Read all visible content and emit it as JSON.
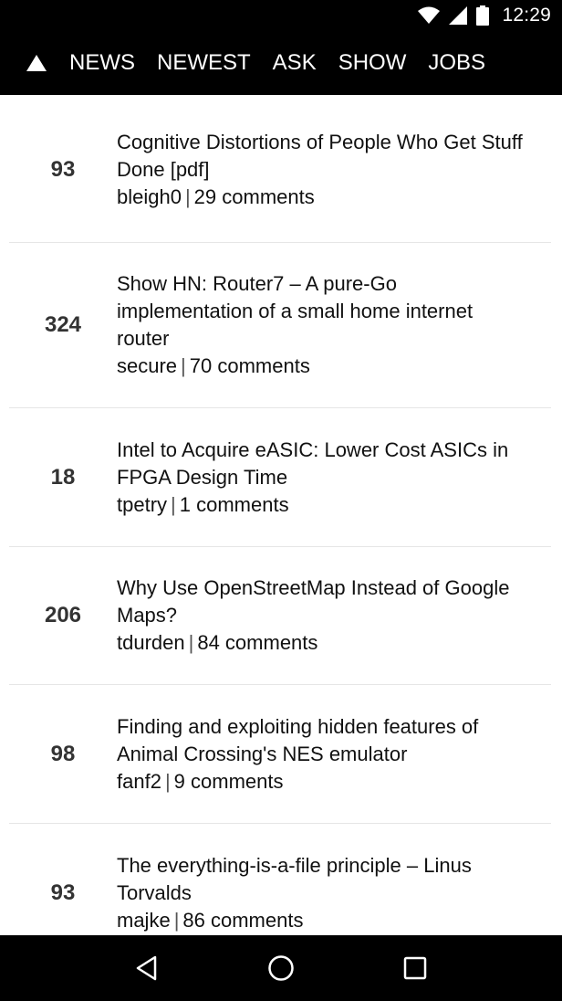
{
  "status_bar": {
    "time": "12:29",
    "icons": [
      "wifi-icon",
      "cell-signal-icon",
      "battery-icon"
    ]
  },
  "header": {
    "logo_icon": "triangle-up-icon",
    "tabs": [
      {
        "label": "NEWS"
      },
      {
        "label": "NEWEST"
      },
      {
        "label": "ASK"
      },
      {
        "label": "SHOW"
      },
      {
        "label": "JOBS"
      }
    ]
  },
  "stories": [
    {
      "score": "93",
      "title": "Cognitive Distortions of People Who Get Stuff Done [pdf]",
      "author": "bleigh0",
      "comments": "29 comments"
    },
    {
      "score": "324",
      "title": "Show HN: Router7 – A pure-Go implementation of a small home internet router",
      "author": "secure",
      "comments": "70 comments"
    },
    {
      "score": "18",
      "title": "Intel to Acquire eASIC: Lower Cost ASICs in FPGA Design Time",
      "author": "tpetry",
      "comments": "1 comments"
    },
    {
      "score": "206",
      "title": "Why Use OpenStreetMap Instead of Google Maps?",
      "author": "tdurden",
      "comments": "84 comments"
    },
    {
      "score": "98",
      "title": "Finding and exploiting hidden features of Animal Crossing's NES emulator",
      "author": "fanf2",
      "comments": "9 comments"
    },
    {
      "score": "93",
      "title": "The everything-is-a-file principle – Linus Torvalds",
      "author": "majke",
      "comments": "86 comments"
    }
  ],
  "meta_separator": "|",
  "nav_bar": {
    "icons": [
      "back-icon",
      "home-icon",
      "recents-icon"
    ]
  },
  "colors": {
    "header_bg": "#000000",
    "divider": "#e6e6e6",
    "text": "#111111"
  }
}
